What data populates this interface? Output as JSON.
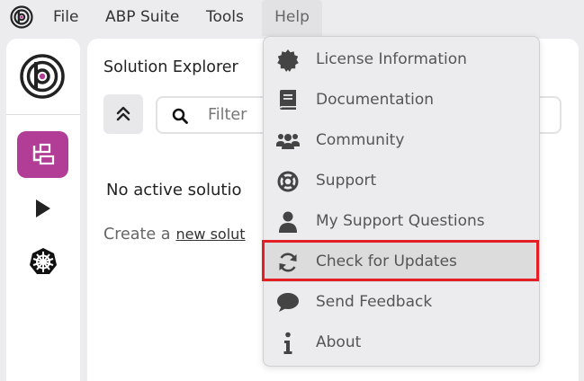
{
  "menubar": {
    "items": [
      {
        "label": "File"
      },
      {
        "label": "ABP Suite"
      },
      {
        "label": "Tools"
      },
      {
        "label": "Help"
      }
    ]
  },
  "main": {
    "title": "Solution Explorer",
    "filter_placeholder": "Filter",
    "no_solution_text": "No active solutio",
    "create_prefix": "Create a",
    "create_link": "new solut"
  },
  "help_menu": {
    "items": [
      {
        "label": "License Information",
        "icon": "certificate-icon"
      },
      {
        "label": "Documentation",
        "icon": "book-icon"
      },
      {
        "label": "Community",
        "icon": "users-icon"
      },
      {
        "label": "Support",
        "icon": "lifebuoy-icon"
      },
      {
        "label": "My Support Questions",
        "icon": "user-icon"
      },
      {
        "label": "Check for Updates",
        "icon": "sync-icon",
        "highlighted": true
      },
      {
        "label": "Send Feedback",
        "icon": "comment-icon"
      },
      {
        "label": "About",
        "icon": "info-icon"
      }
    ]
  },
  "colors": {
    "accent": "#b23d96",
    "highlight_border": "#e31e24",
    "background": "#ecebee"
  }
}
